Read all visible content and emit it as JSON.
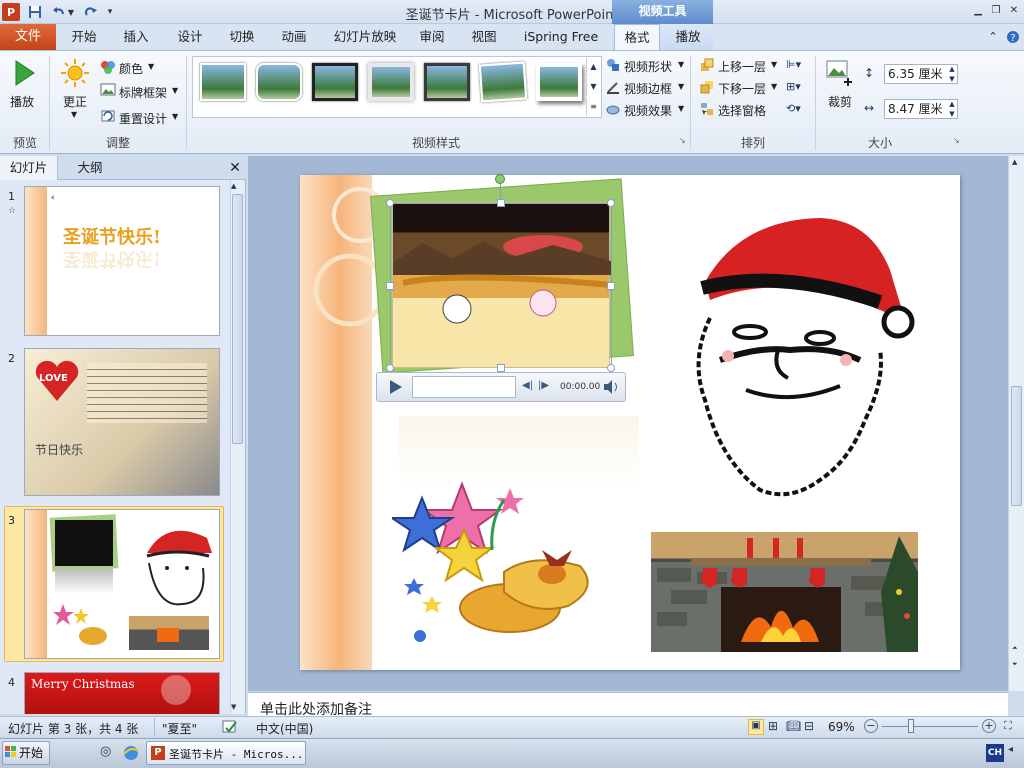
{
  "titlebar": {
    "title": "圣诞节卡片 - Microsoft PowerPoint",
    "context_title": "视频工具",
    "logo_letter": "P"
  },
  "tabs": {
    "file": "文件",
    "items": [
      "开始",
      "插入",
      "设计",
      "切换",
      "动画",
      "幻灯片放映",
      "审阅",
      "视图",
      "iSpring Free",
      "格式",
      "播放"
    ],
    "active": "格式"
  },
  "ribbon": {
    "preview": {
      "play_label": "播放",
      "group": "预览"
    },
    "adjust": {
      "correct_label": "更正",
      "color_label": "颜色",
      "poster_label": "标牌框架",
      "reset_label": "重置设计",
      "group": "调整"
    },
    "video_styles": {
      "group": "视频样式",
      "shape_label": "视频形状",
      "border_label": "视频边框",
      "effects_label": "视频效果"
    },
    "arrange": {
      "group": "排列",
      "bring_forward": "上移一层",
      "send_backward": "下移一层",
      "selection_pane": "选择窗格"
    },
    "size": {
      "group": "大小",
      "crop_label": "裁剪",
      "height": "6.35 厘米",
      "width": "8.47 厘米"
    }
  },
  "left_pane": {
    "tab_slides": "幻灯片",
    "tab_outline": "大纲",
    "slides": [
      {
        "num": "1",
        "title_text": "圣诞节快乐!"
      },
      {
        "num": "2",
        "badge": "LOVE",
        "caption": "节日快乐"
      },
      {
        "num": "3"
      },
      {
        "num": "4",
        "title_text": "Merry Christmas"
      }
    ]
  },
  "video_player": {
    "time": "00:00.00"
  },
  "notes": {
    "placeholder": "单击此处添加备注"
  },
  "status": {
    "slide_info": "幻灯片 第 3 张，共 4 张",
    "theme": "\"夏至\"",
    "language": "中文(中国)",
    "zoom": "69%"
  },
  "taskbar": {
    "start": "开始",
    "window_label": "圣诞节卡片 - Micros...",
    "ime": "CH"
  }
}
